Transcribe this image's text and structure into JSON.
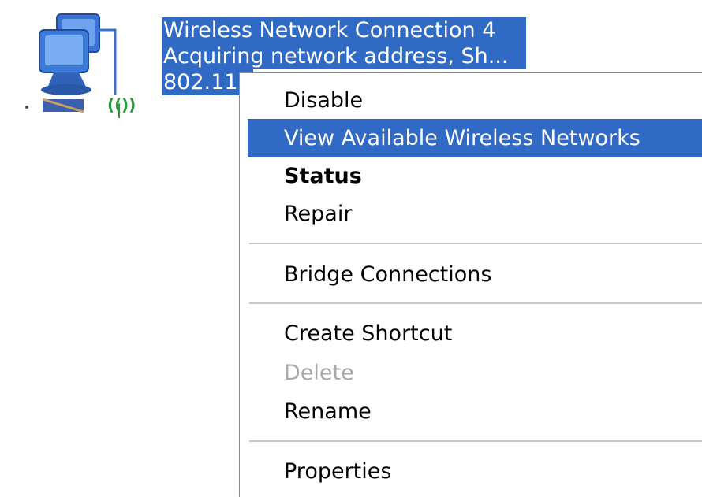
{
  "connection": {
    "name": "Wireless Network Connection 4",
    "status": "Acquiring network address, Sh...",
    "device": "802.11"
  },
  "context_menu": {
    "items": [
      {
        "label": "Disable",
        "state": "normal"
      },
      {
        "label": "View Available Wireless Networks",
        "state": "highlighted"
      },
      {
        "label": "Status",
        "state": "default-bold"
      },
      {
        "label": "Repair",
        "state": "normal"
      },
      {
        "label": "Bridge Connections",
        "state": "normal"
      },
      {
        "label": "Create Shortcut",
        "state": "normal"
      },
      {
        "label": "Delete",
        "state": "disabled"
      },
      {
        "label": "Rename",
        "state": "normal"
      },
      {
        "label": "Properties",
        "state": "normal"
      }
    ]
  },
  "colors": {
    "selection": "#316ac5",
    "disabled_text": "#a8a8a8",
    "separator": "#c8c8c8"
  }
}
